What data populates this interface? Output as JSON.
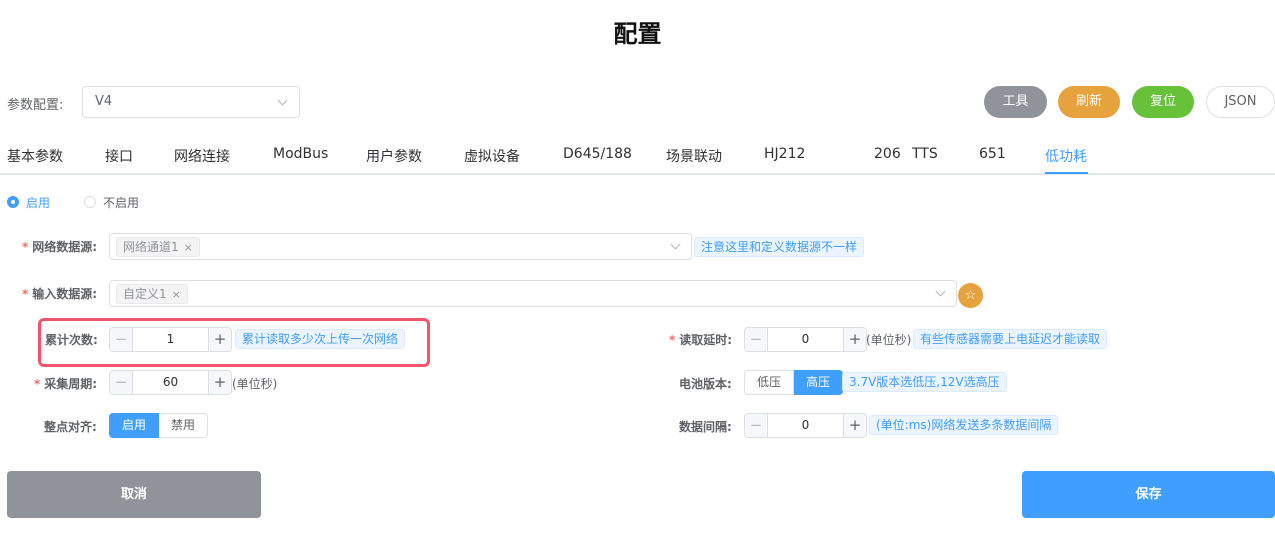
{
  "page": {
    "title": "配置"
  },
  "param_config": {
    "label": "参数配置:",
    "value": "V4"
  },
  "toolbar": {
    "tool": "工具",
    "refresh": "刷新",
    "reset": "复位",
    "json": "JSON"
  },
  "tabs": [
    "基本参数",
    "接口",
    "网络连接",
    "ModBus",
    "用户参数",
    "虚拟设备",
    "D645/188",
    "场景联动",
    "HJ212",
    "206",
    "TTS",
    "651",
    "低功耗"
  ],
  "active_tab": "低功耗",
  "enable_radio": {
    "on_label": "启用",
    "off_label": "不启用",
    "selected": "启用"
  },
  "form": {
    "net_source": {
      "label": "网络数据源:",
      "tag": "网络通道1",
      "hint": "注意这里和定义数据源不一样"
    },
    "input_source": {
      "label": "输入数据源:",
      "tag": "自定义1"
    },
    "count": {
      "label": "累计次数:",
      "value": "1",
      "hint": "累计读取多少次上传一次网络"
    },
    "period": {
      "label": "采集周期:",
      "value": "60",
      "unit": "(单位秒)"
    },
    "align": {
      "label": "整点对齐:",
      "on": "启用",
      "off": "禁用",
      "selected": "启用"
    },
    "read_delay": {
      "label": "读取延时:",
      "value": "0",
      "unit": "(单位秒)",
      "hint": "有些传感器需要上电延迟才能读取"
    },
    "battery": {
      "label": "电池版本:",
      "low": "低压",
      "high": "高压",
      "selected": "高压",
      "hint": "3.7V版本选低压,12V选高压"
    },
    "interval": {
      "label": "数据间隔:",
      "value": "0",
      "hint": "(单位:ms)网络发送多条数据间隔"
    }
  },
  "actions": {
    "cancel": "取消",
    "save": "保存"
  },
  "colors": {
    "primary": "#409eff",
    "warning": "#e6a23c",
    "success": "#67c23a",
    "info": "#909399",
    "highlight": "#f0566a"
  }
}
